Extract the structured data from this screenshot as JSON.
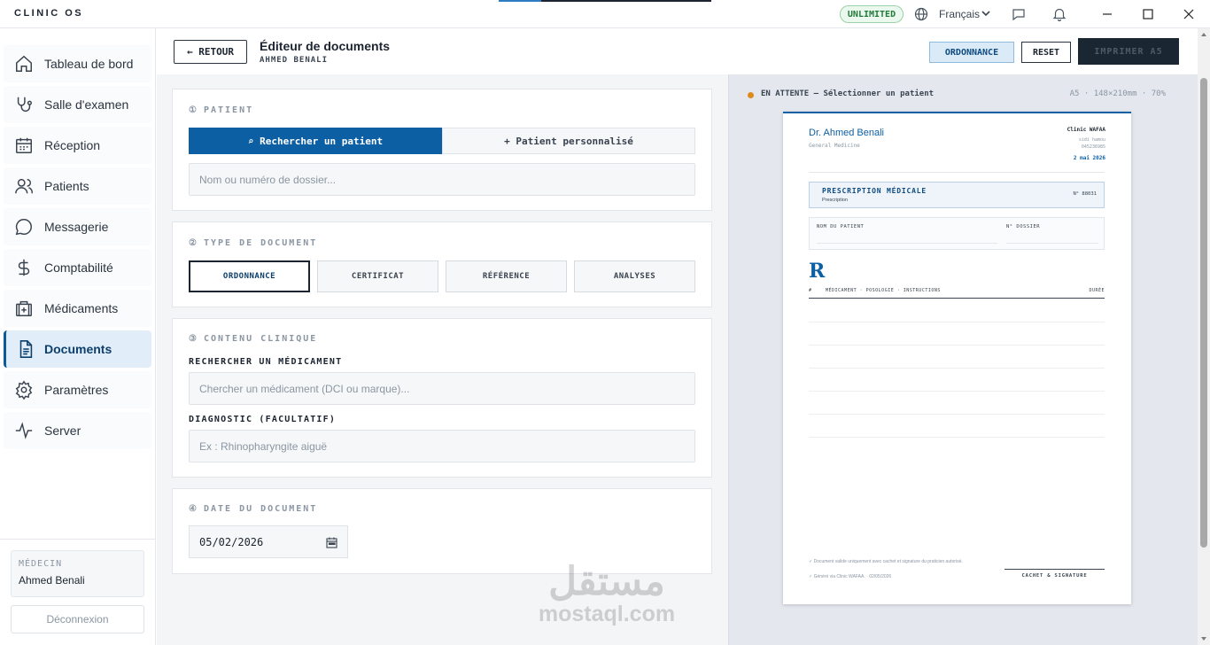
{
  "titlebar": {
    "app_title": "CLINIC OS",
    "top_progress_percent": 20,
    "plan_badge": "UNLIMITED",
    "language": "Français"
  },
  "sidebar": {
    "items": [
      {
        "label": "Tableau de bord",
        "icon": "home-icon"
      },
      {
        "label": "Salle d'examen",
        "icon": "stethoscope-icon"
      },
      {
        "label": "Réception",
        "icon": "calendar-icon"
      },
      {
        "label": "Patients",
        "icon": "users-icon"
      },
      {
        "label": "Messagerie",
        "icon": "message-icon"
      },
      {
        "label": "Comptabilité",
        "icon": "dollar-icon"
      },
      {
        "label": "Médicaments",
        "icon": "medical-kit-icon"
      },
      {
        "label": "Documents",
        "icon": "document-icon",
        "active": true
      },
      {
        "label": "Paramètres",
        "icon": "gear-icon"
      },
      {
        "label": "Server",
        "icon": "activity-icon"
      }
    ],
    "doctor_label": "MÉDECIN",
    "doctor_name": "Ahmed Benali",
    "logout_label": "Déconnexion"
  },
  "header": {
    "back_label": "← RETOUR",
    "title": "Éditeur de documents",
    "subtitle": "AHMED BENALI",
    "doc_type_label": "ORDONNANCE",
    "reset_label": "RESET",
    "print_label": "IMPRIMER A5"
  },
  "patient_section": {
    "number": "①",
    "title": "PATIENT",
    "search_tab": "⌕ Rechercher un patient",
    "custom_tab": "+ Patient personnalisé",
    "search_placeholder": "Nom ou numéro de dossier..."
  },
  "doc_type_section": {
    "number": "②",
    "title": "TYPE DE DOCUMENT",
    "types": [
      "ORDONNANCE",
      "CERTIFICAT",
      "RÉFÉRENCE",
      "ANALYSES"
    ],
    "selected": "ORDONNANCE"
  },
  "clinical_section": {
    "number": "③",
    "title": "CONTENU CLINIQUE",
    "med_label": "RECHERCHER UN MÉDICAMENT",
    "med_placeholder": "Chercher un médicament (DCI ou marque)...",
    "diag_label": "DIAGNOSTIC (FACULTATIF)",
    "diag_placeholder": "Ex : Rhinopharyngite aiguë"
  },
  "date_section": {
    "number": "④",
    "title": "DATE DU DOCUMENT",
    "value": "05/02/2026"
  },
  "preview": {
    "status": "EN ATTENTE — Sélectionner un patient",
    "status_color": "#e08a1e",
    "meta": "A5 · 148×210mm · 70%",
    "paper": {
      "doctor_name": "Dr. Ahmed Benali",
      "specialty": "General Medicine",
      "clinic": "Clinic WAFAA",
      "city": "sidi hamou",
      "phone": "045236985",
      "date": "2 mai 2026",
      "rx_title": "PRESCRIPTION MÉDICALE",
      "rx_subtitle": "Prescription",
      "rx_number": "N° 88031",
      "patient_name_label": "NOM DU PATIENT",
      "file_number_label": "N° DOSSIER",
      "rx_symbol": "R",
      "col_num": "#",
      "col_med": "MÉDICAMENT · POSOLOGIE · INSTRUCTIONS",
      "col_duration": "DURÉE",
      "footer_validity": "✓ Document valide uniquement avec cachet et signature du praticien autorisé.",
      "footer_generated": "✓ Généré via Clinic WAFAA. · 02/05/2026",
      "signature_label": "CACHET & SIGNATURE"
    }
  },
  "watermark": {
    "arabic": "مستقل",
    "latin": "mostaql.com"
  },
  "colors": {
    "accent": "#0d5fa3",
    "active_nav_bg": "#e1eef9",
    "print_button_bg": "#1b2633",
    "badge_green": "#227a3a"
  }
}
